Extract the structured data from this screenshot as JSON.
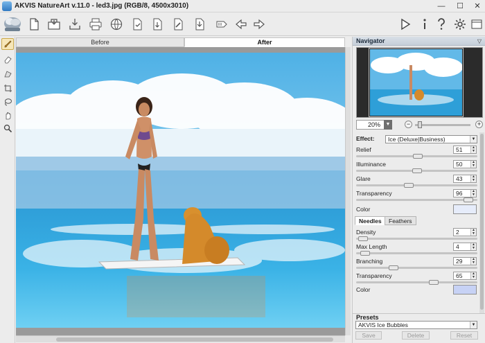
{
  "window": {
    "title": "AKVIS NatureArt v.11.0 - led3.jpg (RGB/8, 4500x3010)",
    "minimize": "▭",
    "maximize": "☐",
    "close": "✕"
  },
  "toolbar": {
    "icons": [
      "new-document",
      "open-image",
      "save-image",
      "print",
      "share",
      "import-preset",
      "export-preset",
      "load-strokes",
      "save-strokes",
      "batch",
      "undo-back",
      "redo-forward"
    ],
    "right_icons": [
      "run",
      "info",
      "help",
      "settings"
    ]
  },
  "tools": [
    "brush",
    "eraser",
    "gradient",
    "crop",
    "lasso",
    "hand",
    "zoom"
  ],
  "view_tabs": {
    "before": "Before",
    "after": "After"
  },
  "navigator": {
    "title": "Navigator",
    "zoom": "20%",
    "zoom_minus": "−",
    "zoom_plus": "+",
    "zoom_level": 0.05
  },
  "effect": {
    "label": "Effect:",
    "value": "Ice (Deluxe|Business)",
    "params": [
      {
        "name": "Relief",
        "value": "51",
        "level": 0.51
      },
      {
        "name": "Illuminance",
        "value": "50",
        "level": 0.5
      },
      {
        "name": "Glare",
        "value": "43",
        "level": 0.43
      },
      {
        "name": "Transparency",
        "value": "96",
        "level": 0.96
      }
    ],
    "color_label": "Color",
    "color": "#e6ecfa"
  },
  "subtabs": {
    "needles": "Needles",
    "feathers": "Feathers"
  },
  "needles": {
    "params": [
      {
        "name": "Density",
        "value": "2",
        "level": 0.02
      },
      {
        "name": "Max Length",
        "value": "4",
        "level": 0.04
      },
      {
        "name": "Branching",
        "value": "29",
        "level": 0.29
      },
      {
        "name": "Transparency",
        "value": "65",
        "level": 0.65
      }
    ],
    "color_label": "Color",
    "color": "#c7d2f5"
  },
  "presets": {
    "title": "Presets",
    "value": "AKVIS Ice Bubbles",
    "save": "Save",
    "delete": "Delete",
    "reset": "Reset"
  },
  "scrollbar_grip": "≡"
}
